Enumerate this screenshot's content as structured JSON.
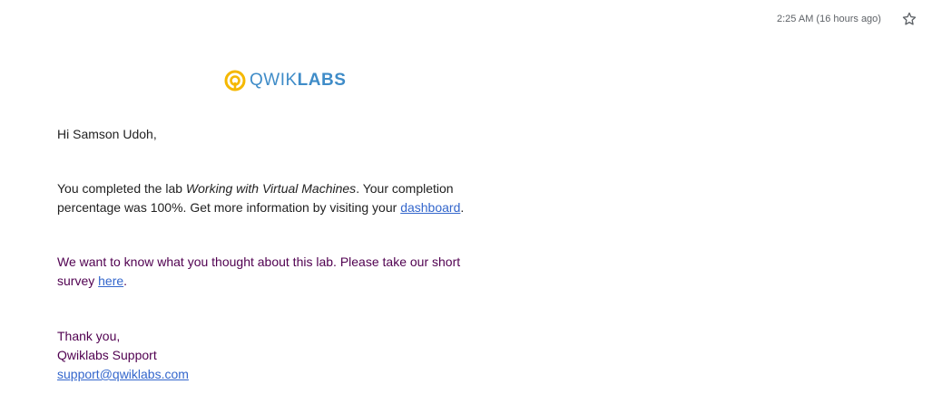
{
  "header": {
    "timestamp": "2:25 AM (16 hours ago)",
    "star_icon": "star-outline-icon"
  },
  "logo": {
    "icon": "qwiklabs-logo-icon",
    "text_light": "QWIK",
    "text_bold": "LABS",
    "brand_color": "#3f8cc8",
    "accent_color": "#f5b800"
  },
  "email": {
    "greeting": "Hi Samson Udoh,",
    "para1": {
      "prefix": "You completed the lab ",
      "lab_name": "Working with Virtual Machines",
      "middle": ". Your completion percentage was 100%. Get more information by visiting your ",
      "link": "dashboard",
      "suffix": "."
    },
    "para2": {
      "prefix": "We want to know what you thought about this lab. Please take our short survey ",
      "link": "here",
      "suffix": "."
    },
    "signoff": {
      "thanks": "Thank you,",
      "sender": "Qwiklabs Support",
      "email": "support@qwiklabs.com"
    }
  },
  "colors": {
    "text": "#222222",
    "quoted_text": "#500050",
    "link": "#3366cc",
    "meta": "#5f6368"
  }
}
